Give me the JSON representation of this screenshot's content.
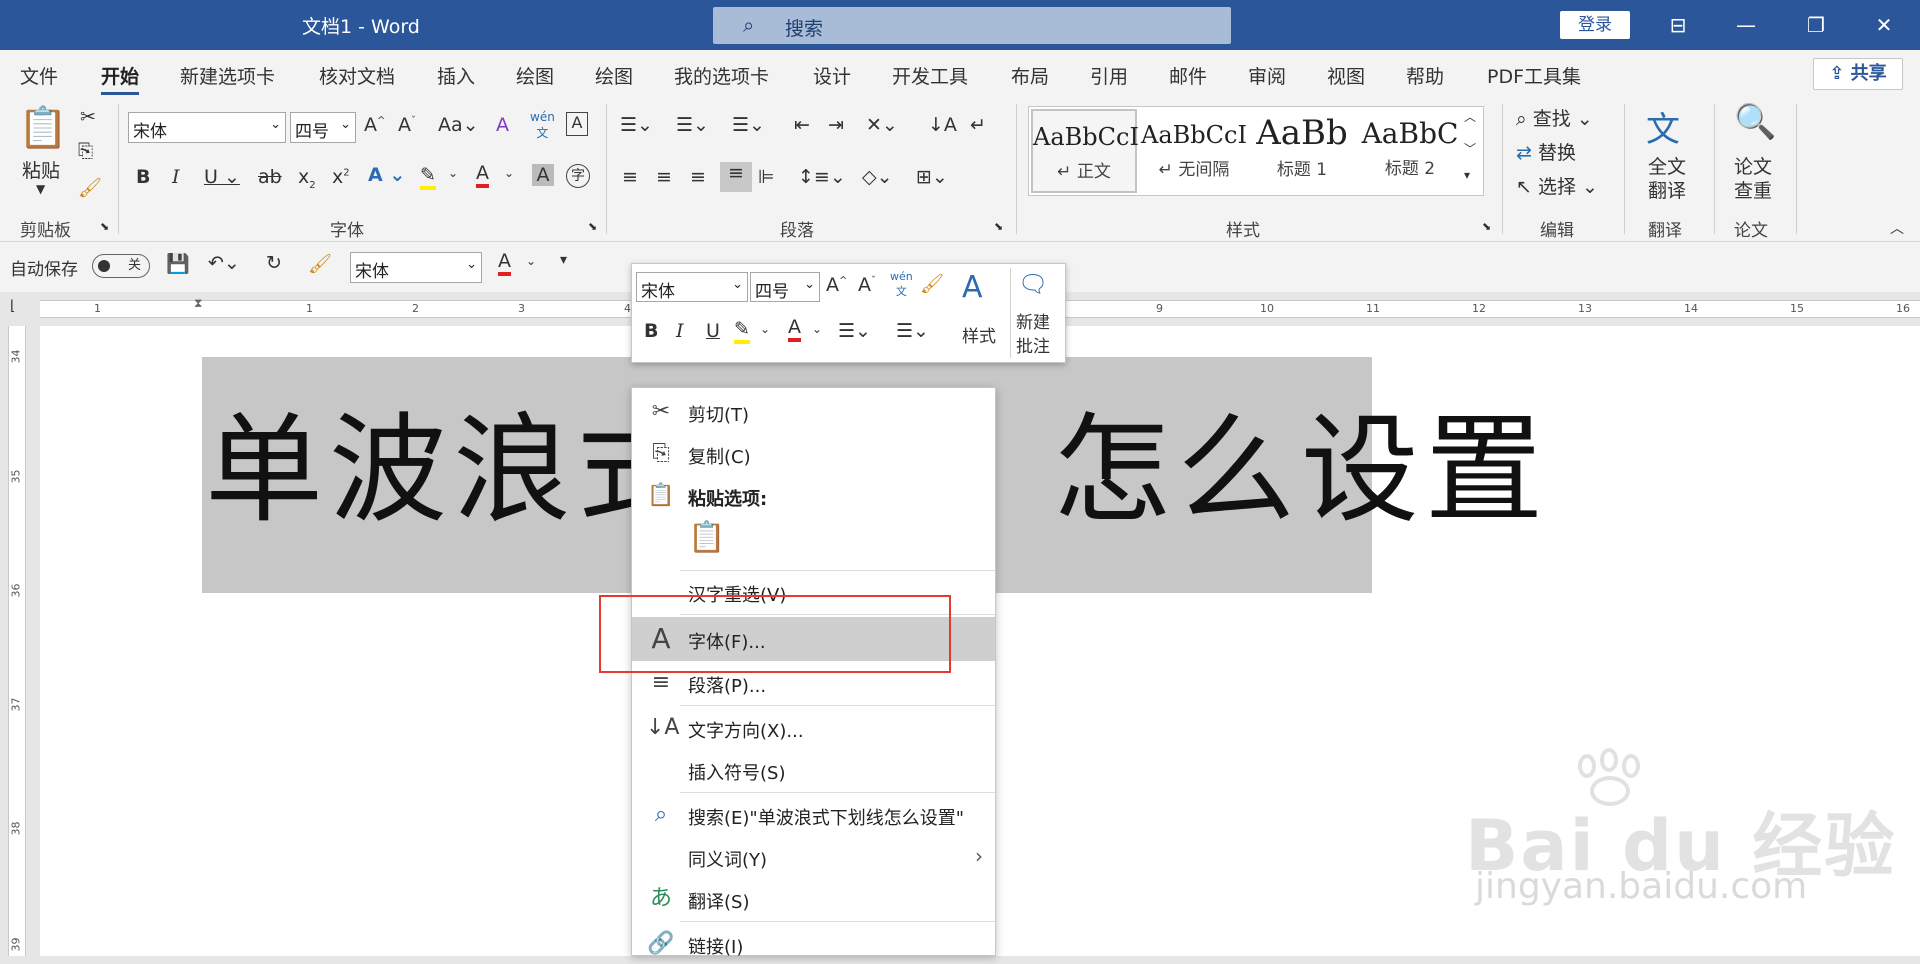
{
  "title_bar": {
    "doc_title": "文档1  -  Word",
    "search_placeholder": "搜索",
    "login": "登录"
  },
  "tabs": [
    "文件",
    "开始",
    "新建选项卡",
    "核对文档",
    "插入",
    "绘图",
    "绘图",
    "我的选项卡",
    "设计",
    "开发工具",
    "布局",
    "引用",
    "邮件",
    "审阅",
    "视图",
    "帮助",
    "PDF工具集"
  ],
  "active_tab": "开始",
  "share": "共享",
  "ribbon": {
    "clipboard": {
      "paste": "粘贴",
      "label": "剪贴板"
    },
    "font": {
      "font_name": "宋体",
      "font_size": "四号",
      "label": "字体"
    },
    "paragraph": {
      "label": "段落"
    },
    "styles": {
      "label": "样式",
      "items": [
        {
          "preview": "AaBbCcI",
          "name": "↵ 正文"
        },
        {
          "preview": "AaBbCcI",
          "name": "↵ 无间隔"
        },
        {
          "preview": "AaBb",
          "name": "标题 1"
        },
        {
          "preview": "AaBbC",
          "name": "标题 2"
        }
      ]
    },
    "editing": {
      "find": "查找",
      "replace": "替换",
      "select": "选择",
      "label": "编辑"
    },
    "translate": {
      "full": "全文",
      "full2": "翻译",
      "label": "翻译"
    },
    "paper": {
      "check": "论文",
      "check2": "查重",
      "label": "论文"
    }
  },
  "qat": {
    "autosave": "自动保存",
    "autosave_state": "关",
    "font": "宋体"
  },
  "ruler_numbers": [
    "1",
    "1",
    "2",
    "3",
    "4",
    "9",
    "10",
    "11",
    "12",
    "13",
    "14",
    "15",
    "16"
  ],
  "vruler_numbers": [
    "34",
    "35",
    "36",
    "37",
    "38",
    "39"
  ],
  "document": {
    "heading": "单波浪式下划线怎么设置",
    "heading_visible_left": "单波浪式",
    "heading_visible_right": "怎么设置"
  },
  "mini_toolbar": {
    "font": "宋体",
    "size": "四号",
    "styles": "样式",
    "new_comment": "新建",
    "new_comment2": "批注"
  },
  "context_menu": [
    {
      "icon": "scissors-icon",
      "label": "剪切(T)"
    },
    {
      "icon": "copy-icon",
      "label": "复制(C)"
    },
    {
      "icon": "paste-options-icon",
      "label": "粘贴选项:"
    },
    {
      "icon": "keep-text-only-icon",
      "label": ""
    },
    {
      "icon": "",
      "label": "汉字重选(V)"
    },
    {
      "icon": "font-icon",
      "label": "字体(F)..."
    },
    {
      "icon": "paragraph-icon",
      "label": "段落(P)..."
    },
    {
      "icon": "text-direction-icon",
      "label": "文字方向(X)..."
    },
    {
      "icon": "",
      "label": "插入符号(S)"
    },
    {
      "icon": "smart-lookup-icon",
      "label": "搜索(E)\"单波浪式下划线怎么设置\""
    },
    {
      "icon": "",
      "label": "同义词(Y)"
    },
    {
      "icon": "translate-icon",
      "label": "翻译(S)"
    },
    {
      "icon": "link-icon",
      "label": "链接(I)"
    }
  ],
  "watermark": {
    "logo": "Bai du 经验",
    "url": "jingyan.baidu.com"
  }
}
